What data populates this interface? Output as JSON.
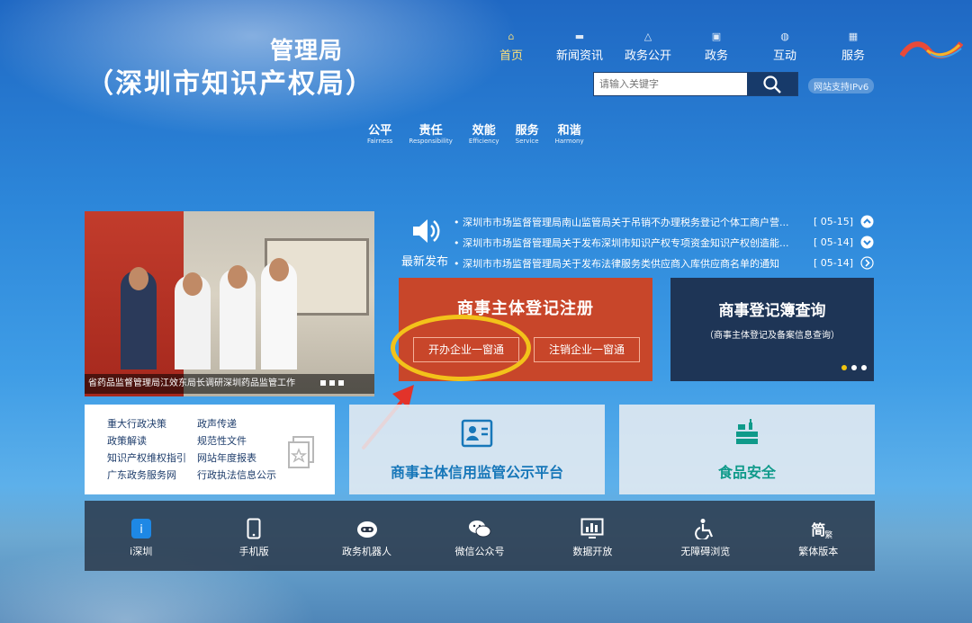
{
  "header": {
    "title_line1": "管理局",
    "title_line2": "（深圳市知识产权局）"
  },
  "nav": [
    {
      "label": "首页",
      "icon": "home-icon",
      "active": true
    },
    {
      "label": "新闻资讯",
      "icon": "news-icon"
    },
    {
      "label": "政务公开",
      "icon": "network-icon"
    },
    {
      "label": "政务",
      "icon": "briefcase-icon"
    },
    {
      "label": "互动",
      "icon": "chat-icon"
    },
    {
      "label": "服务",
      "icon": "grid-icon"
    }
  ],
  "search": {
    "placeholder": "请输入关键字"
  },
  "ipv6": "网站支持IPv6",
  "values": [
    {
      "cn": "公平",
      "en": "Fairness"
    },
    {
      "cn": "责任",
      "en": "Responsibility"
    },
    {
      "cn": "效能",
      "en": "Efficiency"
    },
    {
      "cn": "服务",
      "en": "Service"
    },
    {
      "cn": "和谐",
      "en": "Harmony"
    }
  ],
  "slider": {
    "caption": "省药品监督管理局江效东局长调研深圳药品监管工作"
  },
  "latest": {
    "label": "最新发布",
    "items": [
      {
        "title": "• 深圳市市场监督管理局南山监管局关于吊销不办理税务登记个体工商户营...",
        "date": "[ 05-15]"
      },
      {
        "title": "• 深圳市市场监督管理局关于发布深圳市知识产权专项资金知识产权创造能...",
        "date": "[ 05-14]"
      },
      {
        "title": "• 深圳市市场监督管理局关于发布法律服务类供应商入库供应商名单的通知",
        "date": "[ 05-14]"
      }
    ]
  },
  "registration": {
    "title": "商事主体登记注册",
    "open_btn": "开办企业一窗通",
    "close_btn": "注销企业一窗通"
  },
  "query": {
    "title": "商事登记簿查询",
    "subtitle": "（商事主体登记及备案信息查询）"
  },
  "links": [
    "重大行政决策",
    "政声传递",
    "政策解读",
    "规范性文件",
    "知识产权维权指引",
    "网站年度报表",
    "广东政务服务网",
    "行政执法信息公示"
  ],
  "panels": {
    "credit": "商事主体信用监管公示平台",
    "food": "食品安全"
  },
  "toolbar": [
    {
      "label": "i深圳",
      "icon": "i-shenzhen-icon"
    },
    {
      "label": "手机版",
      "icon": "mobile-icon"
    },
    {
      "label": "政务机器人",
      "icon": "robot-icon"
    },
    {
      "label": "微信公众号",
      "icon": "wechat-icon"
    },
    {
      "label": "数据开放",
      "icon": "chart-icon"
    },
    {
      "label": "无障碍浏览",
      "icon": "accessibility-icon"
    },
    {
      "label": "繁体版本",
      "icon": "traditional-icon",
      "glyph_main": "简",
      "glyph_sub": "繁"
    }
  ],
  "colors": {
    "registration_bg": "#c8462a",
    "query_bg": "#1e3556",
    "highlight": "#f3c21a",
    "arrow": "#e2332a"
  }
}
